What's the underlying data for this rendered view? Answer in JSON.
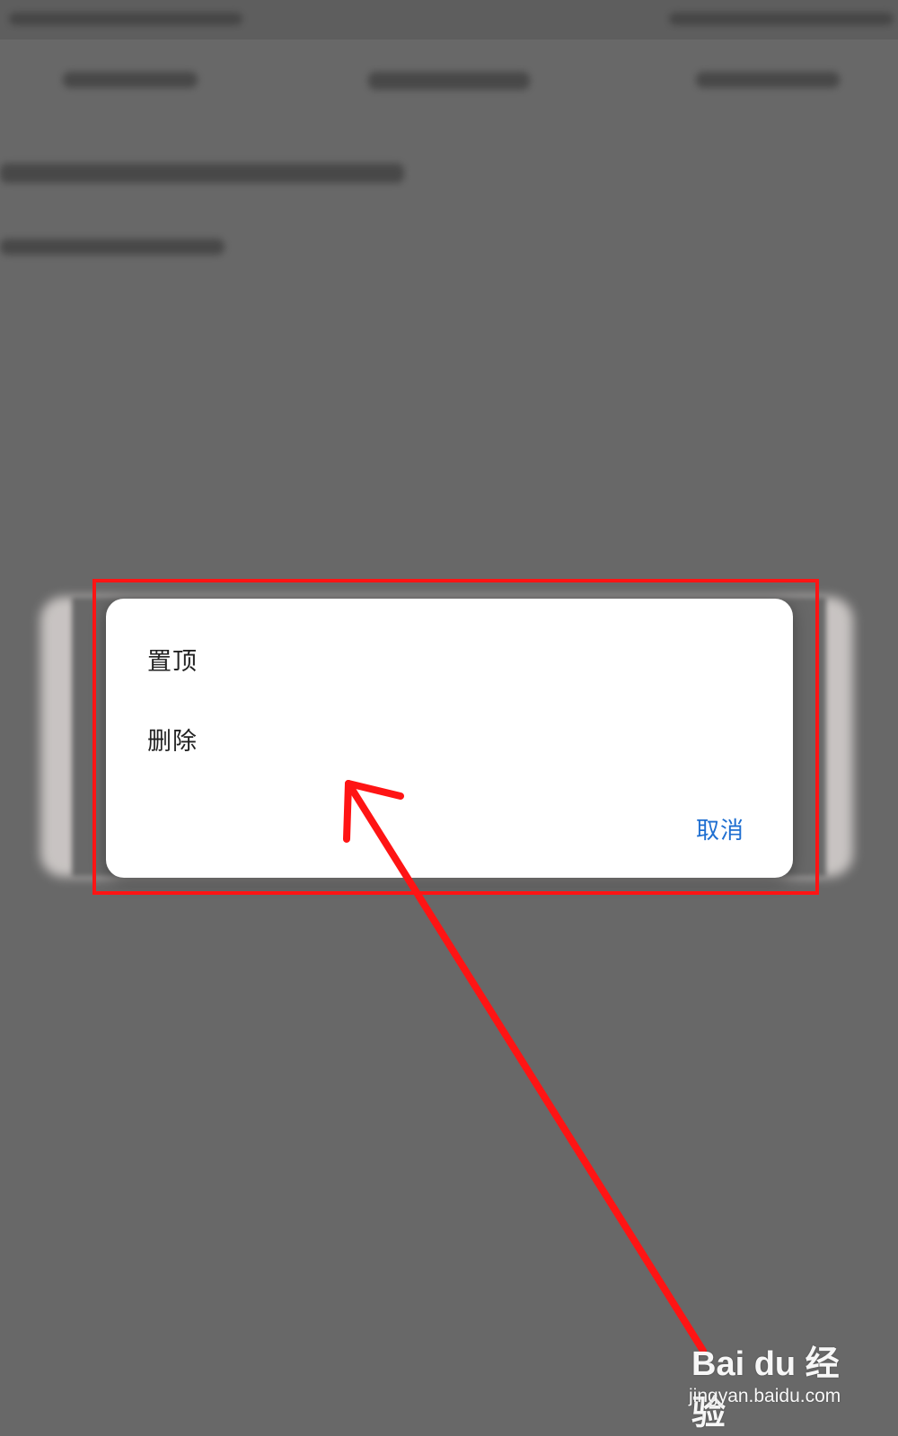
{
  "dialog": {
    "items": [
      {
        "label": "置顶"
      },
      {
        "label": "删除"
      }
    ],
    "cancel_label": "取消"
  },
  "watermark": {
    "logo": "Bai du 经验",
    "url": "jingyan.baidu.com"
  },
  "colors": {
    "overlay": "#686868",
    "dialog_bg": "#ffffff",
    "cancel_text": "#1f6fd1",
    "annotation": "#ff1414"
  }
}
